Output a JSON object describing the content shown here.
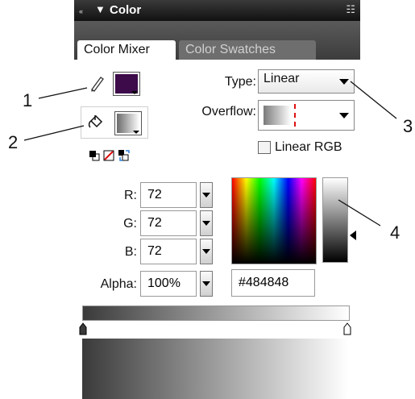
{
  "panel": {
    "title": "Color",
    "collapse_glyph": "«",
    "menu_glyph": "☷"
  },
  "tabs": [
    {
      "label": "Color Mixer",
      "active": true
    },
    {
      "label": "Color Swatches",
      "active": false
    }
  ],
  "stroke_color": "#3d0a4a",
  "fill_color_swatch": "gradient #6b6b6b to #ffffff",
  "type": {
    "label": "Type:",
    "value": "Linear"
  },
  "overflow": {
    "label": "Overflow:"
  },
  "linear_rgb": {
    "label": "Linear RGB",
    "checked": false
  },
  "channels": [
    {
      "label": "R:",
      "value": "72"
    },
    {
      "label": "G:",
      "value": "72"
    },
    {
      "label": "B:",
      "value": "72"
    },
    {
      "label": "Alpha:",
      "value": "100%"
    }
  ],
  "hex": "#484848",
  "callouts": [
    "1",
    "2",
    "3",
    "4"
  ],
  "icons": {
    "stroke": "pencil-icon",
    "fill": "paint-bucket-icon",
    "black_white": "black-white-icon",
    "no_color": "no-color-icon",
    "swap": "swap-colors-icon"
  }
}
